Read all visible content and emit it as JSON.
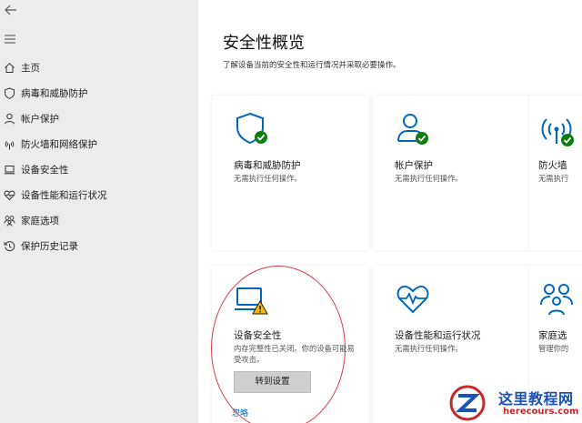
{
  "sidebar": {
    "items": [
      {
        "label": "主页",
        "icon": "home-icon"
      },
      {
        "label": "病毒和威胁防护",
        "icon": "shield-icon"
      },
      {
        "label": "帐户保护",
        "icon": "person-icon"
      },
      {
        "label": "防火墙和网络保护",
        "icon": "wifi-icon"
      },
      {
        "label": "设备安全性",
        "icon": "laptop-icon"
      },
      {
        "label": "设备性能和运行状况",
        "icon": "heart-pulse-icon"
      },
      {
        "label": "家庭选项",
        "icon": "family-icon"
      },
      {
        "label": "保护历史记录",
        "icon": "history-icon"
      }
    ]
  },
  "main": {
    "title": "安全性概览",
    "subtitle": "了解设备当前的安全性和运行情况并采取必要操作。",
    "cards": [
      {
        "title": "病毒和威胁防护",
        "desc": "无需执行任何操作。",
        "icon": "shield-icon",
        "status": "ok"
      },
      {
        "title": "帐户保护",
        "desc": "无需执行任何操作。",
        "icon": "person-icon",
        "status": "ok"
      },
      {
        "title": "防火墙",
        "desc": "无需执行",
        "icon": "wifi-icon",
        "status": "ok"
      },
      {
        "title": "设备安全性",
        "desc": "内存完整性已关闭。你的设备可能易受攻击。",
        "icon": "laptop-icon",
        "status": "warning",
        "button": "转到设置",
        "link": "忽略"
      },
      {
        "title": "设备性能和运行状况",
        "desc": "无需执行任何操作。",
        "icon": "heart-pulse-icon",
        "status": "ok"
      },
      {
        "title": "家庭选",
        "desc": "管理你的",
        "icon": "family-icon",
        "status": "none"
      }
    ]
  },
  "watermark": {
    "title": "这里教程网",
    "url": "herecours.com"
  },
  "colors": {
    "accent": "#0067c0",
    "ok": "#107c10",
    "warning": "#ffb900",
    "sidebar_bg": "#ececec",
    "annotation": "#d9404a"
  }
}
